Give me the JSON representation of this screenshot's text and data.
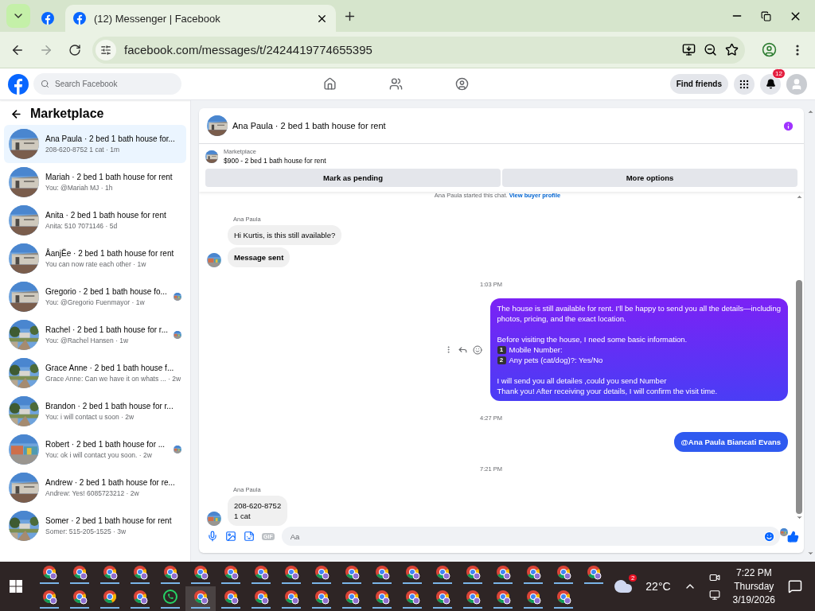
{
  "browser": {
    "tabs": [
      {
        "kind": "pinned",
        "selected": false
      },
      {
        "kind": "normal",
        "title": "(12) Messenger | Facebook",
        "selected": true
      }
    ],
    "url": "facebook.com/messages/t/2424419774655395"
  },
  "facebook": {
    "search_placeholder": "Search Facebook",
    "nav": [
      {
        "kind": "home",
        "selected": false
      },
      {
        "kind": "friends",
        "selected": false
      },
      {
        "kind": "groups",
        "selected": false
      }
    ],
    "find_friends": "Find friends",
    "notification_count": "12"
  },
  "sidebar": {
    "title": "Marketplace",
    "conversations": [
      {
        "title": "Ana Paula · 2 bed 1 bath house for...",
        "preview": "208-620-8752 1 cat · 1m",
        "selected": true,
        "read_receipt": false
      },
      {
        "title": "Mariah · 2 bed 1 bath house for rent",
        "preview": "You: @Mariah MJ · 1h",
        "selected": false,
        "read_receipt": false
      },
      {
        "title": "Anita · 2 bed 1 bath house for rent",
        "preview": "Anita: 510 7071146 · 5d",
        "selected": false,
        "read_receipt": false
      },
      {
        "title": "ÅanjĔe · 2 bed 1 bath house for rent",
        "preview": "You can now rate each other · 1w",
        "selected": false,
        "read_receipt": false
      },
      {
        "title": "Gregorio · 2 bed 1 bath house fo...",
        "preview": "You: @Gregorio Fuenmayor · 1w",
        "selected": false,
        "read_receipt": true
      },
      {
        "title": "Rachel · 2 bed 1 bath house for r...",
        "preview": "You: @Rachel Hansen · 1w",
        "selected": false,
        "read_receipt": true
      },
      {
        "title": "Grace Anne · 2 bed 1 bath house f...",
        "preview": "Grace Anne: Can we have it on whats ... · 2w",
        "selected": false,
        "read_receipt": false
      },
      {
        "title": "Brandon · 2 bed 1 bath house for r...",
        "preview": "You: i will contact u soon · 2w",
        "selected": false,
        "read_receipt": false
      },
      {
        "title": "Robert · 2 bed 1 bath house for ...",
        "preview": "You: ok i will contact you soon. · 2w",
        "selected": false,
        "read_receipt": true
      },
      {
        "title": "Andrew · 2 bed 1 bath house for re...",
        "preview": "Andrew: Yes! 6085723212 · 2w",
        "selected": false,
        "read_receipt": false
      },
      {
        "title": "Somer · 2 bed 1 bath house for rent",
        "preview": "Somer: 515-205-1525 · 3w",
        "selected": false,
        "read_receipt": false
      }
    ]
  },
  "chat": {
    "title": "Ana Paula · 2 bed 1 bath house for rent",
    "listing": {
      "label": "Marketplace",
      "text": "$900 - 2 bed 1 bath house for rent"
    },
    "actions": [
      "Mark as pending",
      "More options"
    ],
    "notice": {
      "text": "Ana Paula started this chat.",
      "link": "View buyer profile"
    },
    "items": [
      {
        "kind": "sender",
        "text": "Ana Paula"
      },
      {
        "kind": "incoming",
        "lines": [
          "Hi Kurtis, is this still available?"
        ],
        "bold": false,
        "avatar": false
      },
      {
        "kind": "incoming",
        "lines": [
          "Message sent"
        ],
        "bold": true,
        "avatar": true
      },
      {
        "kind": "time",
        "text": "1:03 PM"
      },
      {
        "kind": "outgoing",
        "hovered": true,
        "bold": false,
        "paragraphs": [
          {
            "lines": [
              {
                "text": "The house is still available for rent. I’ll be happy to send you all the details—including"
              },
              {
                "text": "photos, pricing, and the exact location."
              }
            ]
          },
          {
            "lines": [
              {
                "text": "Before visiting the house, I need some basic information."
              },
              {
                "keycap": "1",
                "text": "Mobile Number:"
              },
              {
                "keycap": "2",
                "text": "Any pets (cat/dog)?: Yes/No"
              }
            ]
          },
          {
            "lines": [
              {
                "text": "I will send you all detailes ,could you send Number"
              },
              {
                "text": "Thank you! After receiving your details, I will confirm the visit time."
              }
            ]
          }
        ]
      },
      {
        "kind": "time",
        "text": "4:27 PM"
      },
      {
        "kind": "outgoing",
        "hovered": false,
        "bold": true,
        "paragraphs": [
          {
            "lines": [
              {
                "text": "@Ana Paula Biancati Evans"
              }
            ]
          }
        ]
      },
      {
        "kind": "time",
        "text": "7:21 PM"
      },
      {
        "kind": "sender",
        "text": "Ana Paula"
      },
      {
        "kind": "incoming",
        "lines": [
          "208-620-8752",
          "1 cat"
        ],
        "bold": false,
        "avatar": true
      }
    ],
    "seen": true,
    "composer": {
      "placeholder": "Aa",
      "gif_label": "GIF"
    }
  },
  "taskbar": {
    "rows": [
      {
        "apps": [
          {
            "kind": "chrome-profile",
            "selected": false
          },
          {
            "kind": "chrome-profile",
            "selected": false
          },
          {
            "kind": "chrome-profile",
            "selected": false
          },
          {
            "kind": "chrome-profile",
            "selected": false
          },
          {
            "kind": "chrome-profile",
            "selected": false
          },
          {
            "kind": "chrome-profile",
            "selected": false
          },
          {
            "kind": "chrome-profile",
            "selected": false
          },
          {
            "kind": "chrome-profile",
            "selected": false
          },
          {
            "kind": "chrome-profile",
            "selected": false
          },
          {
            "kind": "chrome-profile",
            "selected": false
          },
          {
            "kind": "chrome-profile",
            "selected": false
          },
          {
            "kind": "chrome-profile",
            "selected": false
          },
          {
            "kind": "chrome-profile",
            "selected": false
          },
          {
            "kind": "chrome-profile",
            "selected": false
          },
          {
            "kind": "chrome-profile",
            "selected": false
          },
          {
            "kind": "chrome-profile",
            "selected": false
          },
          {
            "kind": "chrome-profile",
            "selected": false
          },
          {
            "kind": "chrome-profile",
            "selected": false
          },
          {
            "kind": "chrome-profile",
            "selected": false
          }
        ]
      },
      {
        "apps": [
          {
            "kind": "chrome-profile",
            "selected": false
          },
          {
            "kind": "chrome-profile",
            "selected": false
          },
          {
            "kind": "chrome",
            "selected": false
          },
          {
            "kind": "chrome-profile",
            "selected": false
          },
          {
            "kind": "whatsapp",
            "selected": false
          },
          {
            "kind": "chrome-profile",
            "selected": true
          },
          {
            "kind": "chrome-profile",
            "selected": false
          },
          {
            "kind": "chrome-profile",
            "selected": false
          },
          {
            "kind": "chrome-profile",
            "selected": false
          },
          {
            "kind": "chrome-profile",
            "selected": false
          },
          {
            "kind": "chrome-profile",
            "selected": false
          },
          {
            "kind": "chrome-profile",
            "selected": false
          },
          {
            "kind": "chrome-profile",
            "selected": false
          },
          {
            "kind": "chrome-profile",
            "selected": false
          },
          {
            "kind": "chrome-profile",
            "selected": false
          },
          {
            "kind": "chrome-profile",
            "selected": false
          },
          {
            "kind": "chrome-profile",
            "selected": false
          },
          {
            "kind": "chrome-profile",
            "selected": false
          }
        ]
      }
    ],
    "weather_badge": "2",
    "temperature": "22°C",
    "time": "7:22 PM",
    "day": "Thursday",
    "date": "3/19/2026"
  }
}
